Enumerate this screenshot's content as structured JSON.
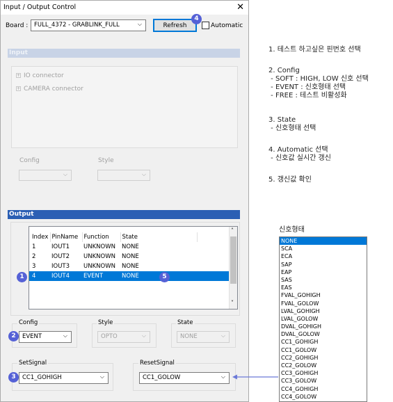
{
  "window": {
    "title": "Input / Output Control",
    "close_glyph": "✕"
  },
  "toolbar": {
    "board_label": "Board :",
    "board_value": "FULL_4372  -  GRABLINK_FULL",
    "refresh_label": "Refresh",
    "automatic_label": "Automatic",
    "automatic_checked": false
  },
  "input": {
    "header": "Input",
    "tree": [
      "IO connector",
      "CAMERA connector"
    ],
    "config_label": "Config",
    "style_label": "Style"
  },
  "output": {
    "header": "Output",
    "columns": [
      "Index",
      "PinName",
      "Function",
      "State"
    ],
    "rows": [
      [
        "1",
        "IOUT1",
        "UNKNOWN",
        "NONE"
      ],
      [
        "2",
        "IOUT2",
        "UNKNOWN",
        "NONE"
      ],
      [
        "3",
        "IOUT3",
        "UNKNOWN",
        "NONE"
      ],
      [
        "4",
        "IOUT4",
        "EVENT",
        "NONE"
      ]
    ],
    "selected_row": 3,
    "config_label": "Config",
    "config_value": "EVENT",
    "style_label": "Style",
    "style_value": "OPTO",
    "state_label": "State",
    "state_value": "NONE",
    "setsignal_label": "SetSignal",
    "setsignal_value": "CC1_GOHIGH",
    "resetsignal_label": "ResetSignal",
    "resetsignal_value": "CC1_GOLOW"
  },
  "badges": [
    "1",
    "2",
    "3",
    "4",
    "5"
  ],
  "notes": [
    "1. 테스트 하고싶은 핀번호 선택",
    "2. Config\n - SOFT : HIGH, LOW 신호 선택\n - EVENT : 신호형태 선택\n - FREE : 테스트 비활성화",
    "3. State\n - 신호형태 선택",
    "4. Automatic 선택\n - 신호값 실시간 갱신",
    "5. 갱신값 확인"
  ],
  "signal_list": {
    "title": "신호형태",
    "options": [
      "NONE",
      "SCA",
      "ECA",
      "SAP",
      "EAP",
      "SAS",
      "EAS",
      "FVAL_GOHIGH",
      "FVAL_GOLOW",
      "LVAL_GOHIGH",
      "LVAL_GOLOW",
      "DVAL_GOHIGH",
      "DVAL_GOLOW",
      "CC1_GOHIGH",
      "CC1_GOLOW",
      "CC2_GOHIGH",
      "CC2_GOLOW",
      "CC3_GOHIGH",
      "CC3_GOLOW",
      "CC4_GOHIGH",
      "CC4_GOLOW"
    ],
    "selected": 0
  },
  "colors": {
    "section_bar": "#2b5fb4",
    "input_bar": "#c8d3e6",
    "selection": "#0078d7",
    "badge": "#5561d6",
    "arrow": "#6b79d8"
  },
  "chevron": "⌵"
}
